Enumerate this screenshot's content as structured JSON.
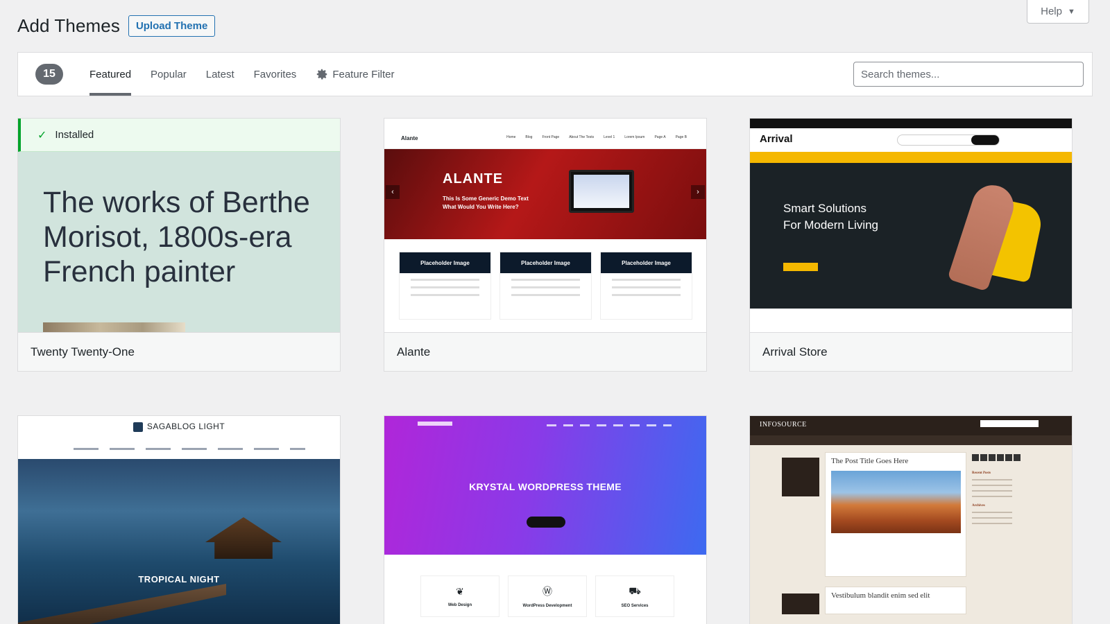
{
  "header": {
    "title": "Add Themes",
    "upload_label": "Upload Theme"
  },
  "help": {
    "label": "Help",
    "caret": "▼"
  },
  "filter": {
    "count": "15",
    "tabs": [
      {
        "label": "Featured",
        "active": true
      },
      {
        "label": "Popular"
      },
      {
        "label": "Latest"
      },
      {
        "label": "Favorites"
      },
      {
        "label": "Feature Filter"
      }
    ],
    "search_placeholder": "Search themes..."
  },
  "themes": [
    {
      "name": "Twenty Twenty-One",
      "installed_label": "Installed",
      "headline": "The works of Berthe Morisot, 1800s-era French painter"
    },
    {
      "name": "Alante",
      "hero_title": "ALANTE",
      "hero_sub_1": "This Is Some Generic Demo Text",
      "hero_sub_2": "What Would You Write Here?",
      "box_label": "Placeholder Image"
    },
    {
      "name": "Arrival Store",
      "logo": "Arrival",
      "hero_line_1": "Smart Solutions",
      "hero_line_2": "For Modern Living"
    },
    {
      "name": "Sagablog Light",
      "logo": "SAGABLOG LIGHT",
      "hero_title": "TROPICAL NIGHT"
    },
    {
      "name": "Krystal",
      "hero_title": "KRYSTAL WORDPRESS THEME",
      "services": [
        "Web Design",
        "WordPress Development",
        "SEO Services"
      ]
    },
    {
      "name": "Infosource",
      "logo": "INFOSOURCE",
      "post_1": "The Post Title Goes Here",
      "post_2": "Vestibulum blandit enim sed elit",
      "side_1": "Recent Posts",
      "side_2": "Archives"
    }
  ],
  "colors": {
    "accent": "#2271b1",
    "installed": "#00a32a",
    "badge": "#646970"
  }
}
